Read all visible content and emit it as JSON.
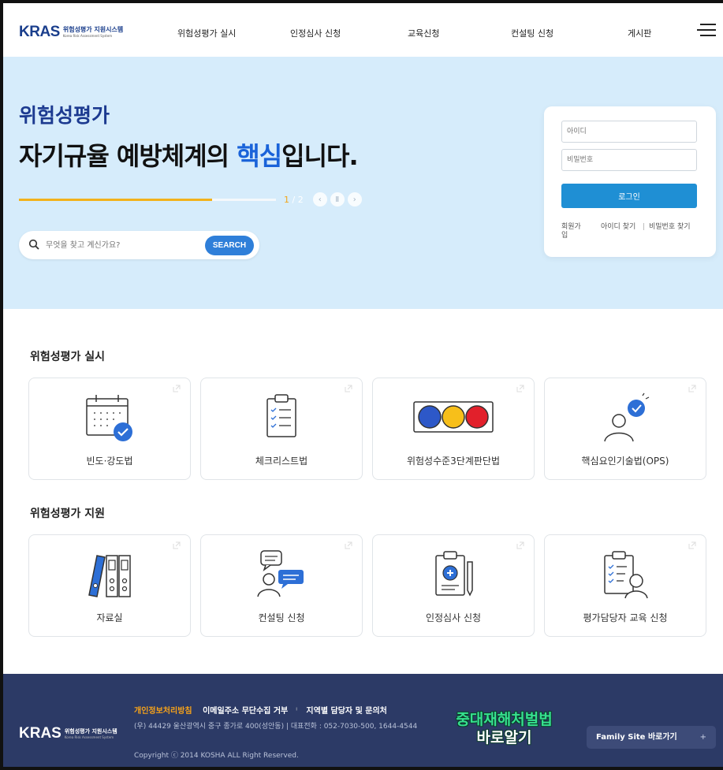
{
  "header": {
    "logo_mark": "KRAS",
    "logo_ko": "위험성평가 지원시스템",
    "logo_en": "Korea Risk Assessment System",
    "nav": [
      "위험성평가 실시",
      "인정심사 신청",
      "교육신청",
      "컨설팅 신청",
      "게시판"
    ]
  },
  "hero": {
    "eyebrow": "위험성평가",
    "headline_before": "자기규율 예방체계의 ",
    "headline_accent": "핵심",
    "headline_after": "입니다.",
    "pager_current": "1",
    "pager_total": " / 2",
    "progress": 0.75,
    "search_placeholder": "무엇을 찾고 계신가요?",
    "search_button": "SEARCH"
  },
  "login": {
    "id_placeholder": "아이디",
    "pw_placeholder": "비밀번호",
    "button": "로그인",
    "links": [
      "회원가입",
      "아이디 찾기",
      "비밀번호 찾기"
    ]
  },
  "section1": {
    "title": "위험성평가 실시",
    "cards": [
      "빈도·강도법",
      "체크리스트법",
      "위험성수준3단계판단법",
      "핵심요인기술법(OPS)"
    ]
  },
  "section2": {
    "title": "위험성평가 지원",
    "cards": [
      "자료실",
      "컨설팅 신청",
      "인정심사 신청",
      "평가담당자 교육 신청"
    ]
  },
  "footer": {
    "logo_mark": "KRAS",
    "logo_ko": "위험성평가 지원시스템",
    "logo_en": "Korea Risk Assessment System",
    "links": [
      "개인정보처리방침",
      "이메일주소 무단수집 거부",
      "지역별 담당자 및 문의처"
    ],
    "address": "(우) 44429 울산광역시 중구 종가로 400(성안동)   |   대표전화 : 052-7030-500, 1644-4544",
    "copyright": "Copyright ⓒ 2014 KOSHA ALL Right Reserved.",
    "banner_line1": "중대재해처벌법",
    "banner_line2": "바로알기",
    "family_site": "Family Site 바로가기",
    "family_plus": "+"
  },
  "colors": {
    "hero_bg": "#d6ecfb",
    "brand_blue": "#1c3a90",
    "accent_blue": "#1a63d9",
    "footer_bg": "#2c3a66",
    "progress_fill": "#f2b21b"
  }
}
